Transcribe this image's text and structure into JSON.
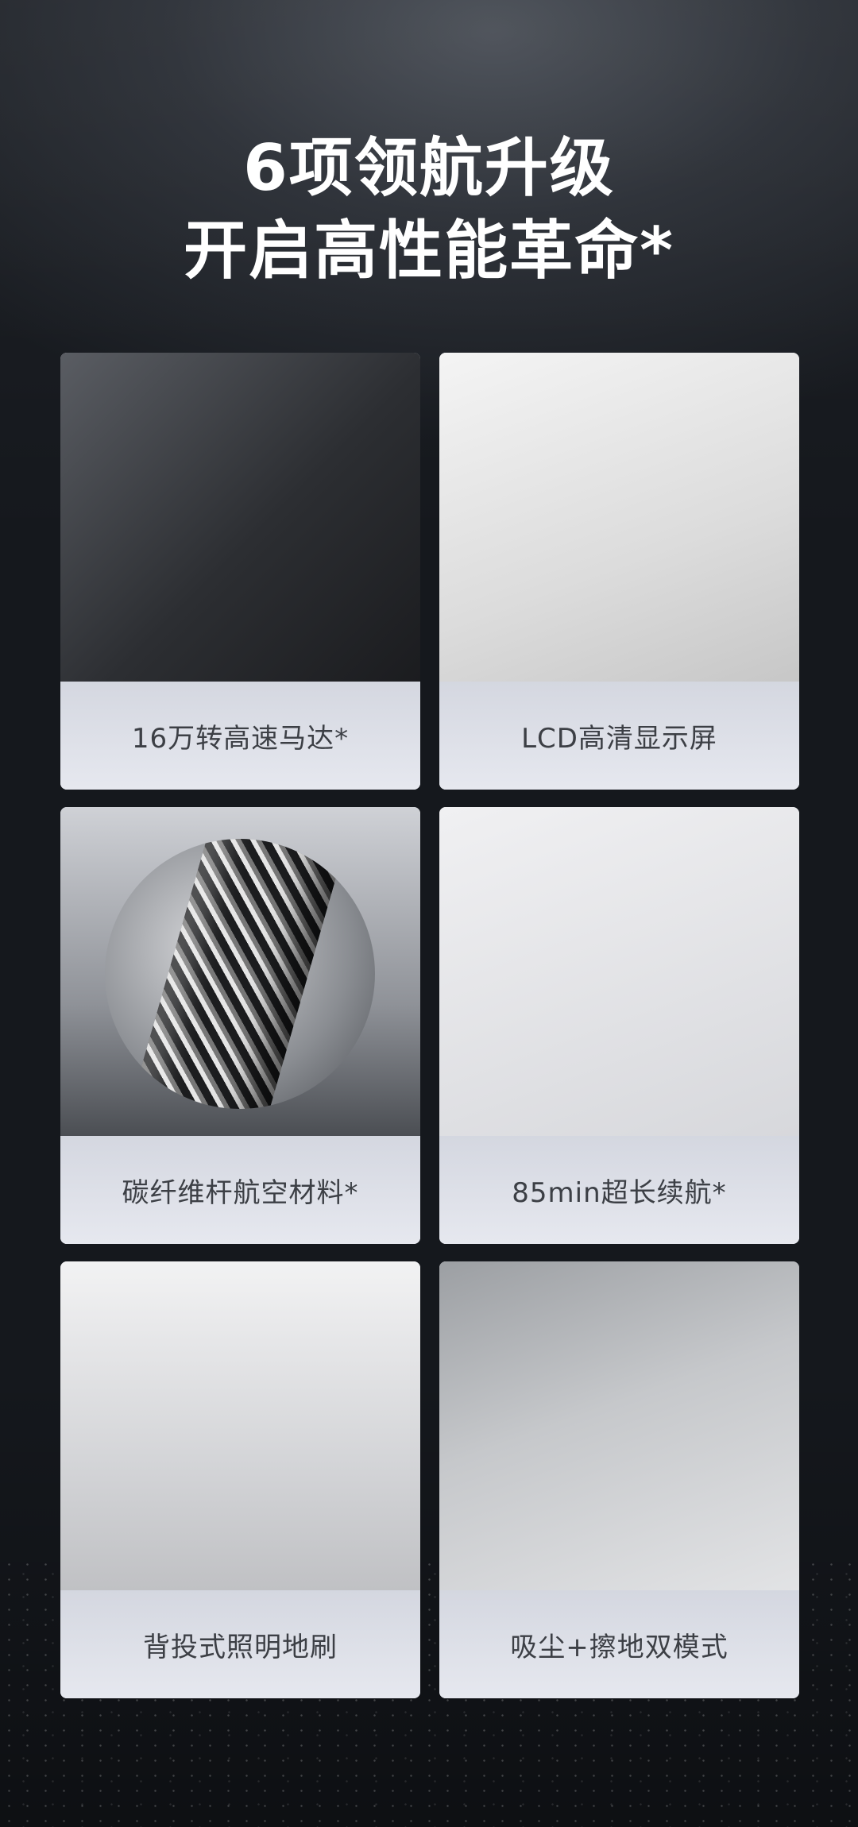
{
  "headline": {
    "line1": "6项领航升级",
    "line2": "开启高性能革命*"
  },
  "features": [
    {
      "caption": "16万转高速马达*",
      "image": "motor-fan-image"
    },
    {
      "caption": "LCD高清显示屏",
      "image": "lcd-handle-image"
    },
    {
      "caption": "碳纤维杆航空材料*",
      "image": "carbon-fiber-tube-image"
    },
    {
      "caption": "85min超长续航*",
      "image": "battery-pack-image"
    },
    {
      "caption": "背投式照明地刷",
      "image": "floor-brush-light-image"
    },
    {
      "caption": "吸尘+擦地双模式",
      "image": "vacuum-mop-mode-image"
    }
  ]
}
